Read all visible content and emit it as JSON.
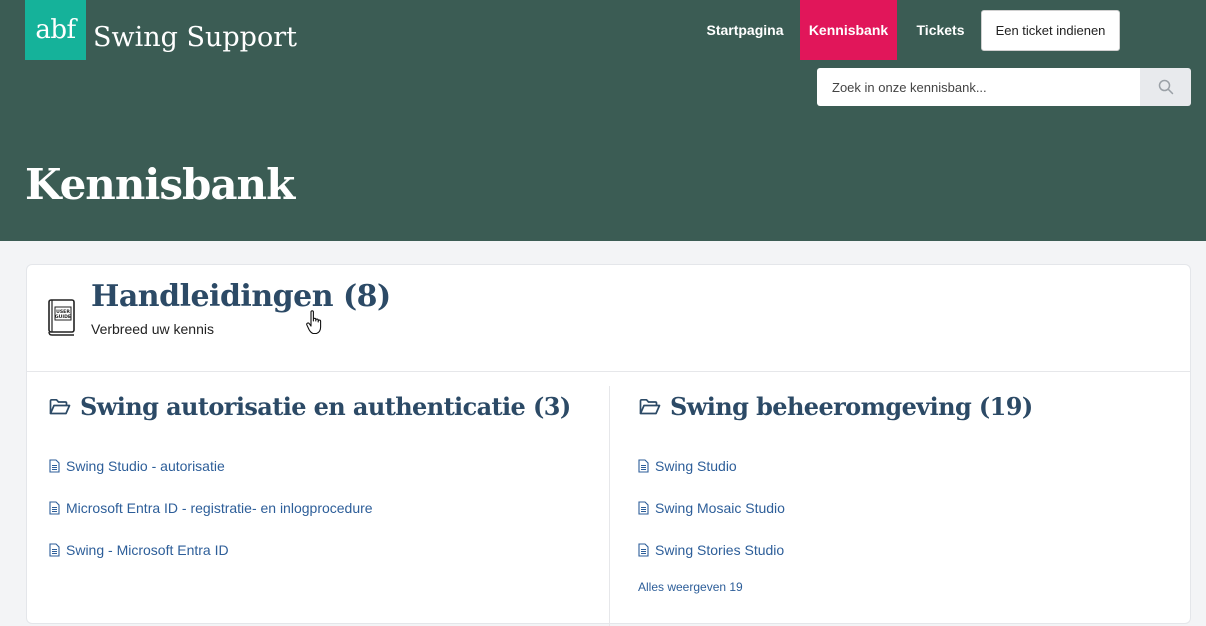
{
  "header": {
    "logo_text": "abf",
    "site_name": "Swing Support",
    "nav": {
      "home": "Startpagina",
      "knowledge_base": "Kennisbank",
      "tickets": "Tickets",
      "submit_ticket": "Een ticket indienen"
    },
    "search": {
      "placeholder": "Zoek in onze kennisbank...",
      "icon": "search-icon"
    },
    "colors": {
      "header_bg": "#3b5c54",
      "logo_bg": "#15b29a",
      "active_nav": "#e1165a"
    },
    "page_title": "Kennisbank"
  },
  "category": {
    "icon": "user-guide-book-icon",
    "icon_text": [
      "USER",
      "GUIDE"
    ],
    "title": "Handleidingen (8)",
    "description": "Verbreed uw kennis",
    "folders": [
      {
        "icon": "folder-open-icon",
        "title": "Swing autorisatie en authenticatie (3)",
        "articles": [
          "Swing Studio - autorisatie",
          "Microsoft Entra ID - registratie- en inlogprocedure",
          "Swing - Microsoft Entra ID"
        ]
      },
      {
        "icon": "folder-open-icon",
        "title": "Swing beheeromgeving (19)",
        "articles": [
          "Swing Studio",
          "Swing Mosaic Studio",
          "Swing Stories Studio"
        ],
        "show_all": "Alles weergeven 19"
      }
    ]
  }
}
